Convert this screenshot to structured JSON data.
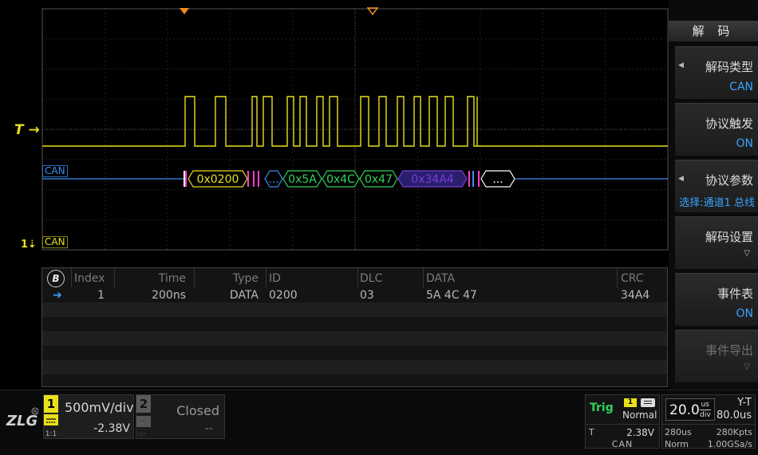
{
  "scope": {
    "decode_label": "CAN",
    "channel_label": "CAN",
    "trigger_marker": "T",
    "ch1_marker": "1",
    "packets": [
      {
        "label": "0x0200",
        "color": "#e9e01c",
        "kind": "id"
      },
      {
        "label": "...",
        "color": "#3d8ef0",
        "kind": "ctrl"
      },
      {
        "label": "0x5A",
        "color": "#2fd45a",
        "kind": "data"
      },
      {
        "label": "0x4C",
        "color": "#2fd45a",
        "kind": "data"
      },
      {
        "label": "0x47",
        "color": "#2fd45a",
        "kind": "data"
      },
      {
        "label": "0x34A4",
        "color": "#7b3cd8",
        "kind": "crc"
      },
      {
        "label": "...",
        "color": "#ffffff",
        "kind": "eof"
      }
    ],
    "colors": {
      "trace": "#e9e01c",
      "bus": "#3d8ef0",
      "grid": "#3a3a3a"
    }
  },
  "events": {
    "bus_badge": "B",
    "headers": {
      "index": "Index",
      "time": "Time",
      "type": "Type",
      "id": "ID",
      "dlc": "DLC",
      "data": "DATA",
      "crc": "CRC"
    },
    "rows": [
      {
        "index": "1",
        "time": "200ns",
        "type": "DATA",
        "id": "0200",
        "dlc": "03",
        "data": "5A 4C 47",
        "crc": "34A4",
        "current": true
      }
    ]
  },
  "menu": {
    "title": "解 码",
    "buttons": [
      {
        "label": "解码类型",
        "value": "CAN"
      },
      {
        "label": "协议触发",
        "value": "ON"
      },
      {
        "label": "协议参数",
        "value": "选择:通道1 总线"
      },
      {
        "label": "解码设置",
        "value": ""
      },
      {
        "label": "事件表",
        "value": "ON"
      },
      {
        "label": "事件导出",
        "value": ""
      }
    ]
  },
  "status": {
    "ch1": {
      "number": "1",
      "scale": "500mV/div",
      "offset": "-2.38V",
      "probe": "1:1"
    },
    "ch2": {
      "number": "2",
      "state": "Closed",
      "offset": "--",
      "probe": "-:-"
    },
    "trigger": {
      "title": "Trig",
      "source": "1",
      "mode": "Normal",
      "type": "T",
      "level": "2.38V",
      "protocol": "CAN"
    },
    "timebase": {
      "value": "20.0",
      "unit_top": "us",
      "unit_bottom": "div",
      "mode": "Y-T",
      "offset": "80.0us",
      "position": "280us",
      "memory": "280Kpts",
      "acq_mode": "Norm",
      "sample_rate": "1.00GSa/s"
    }
  }
}
